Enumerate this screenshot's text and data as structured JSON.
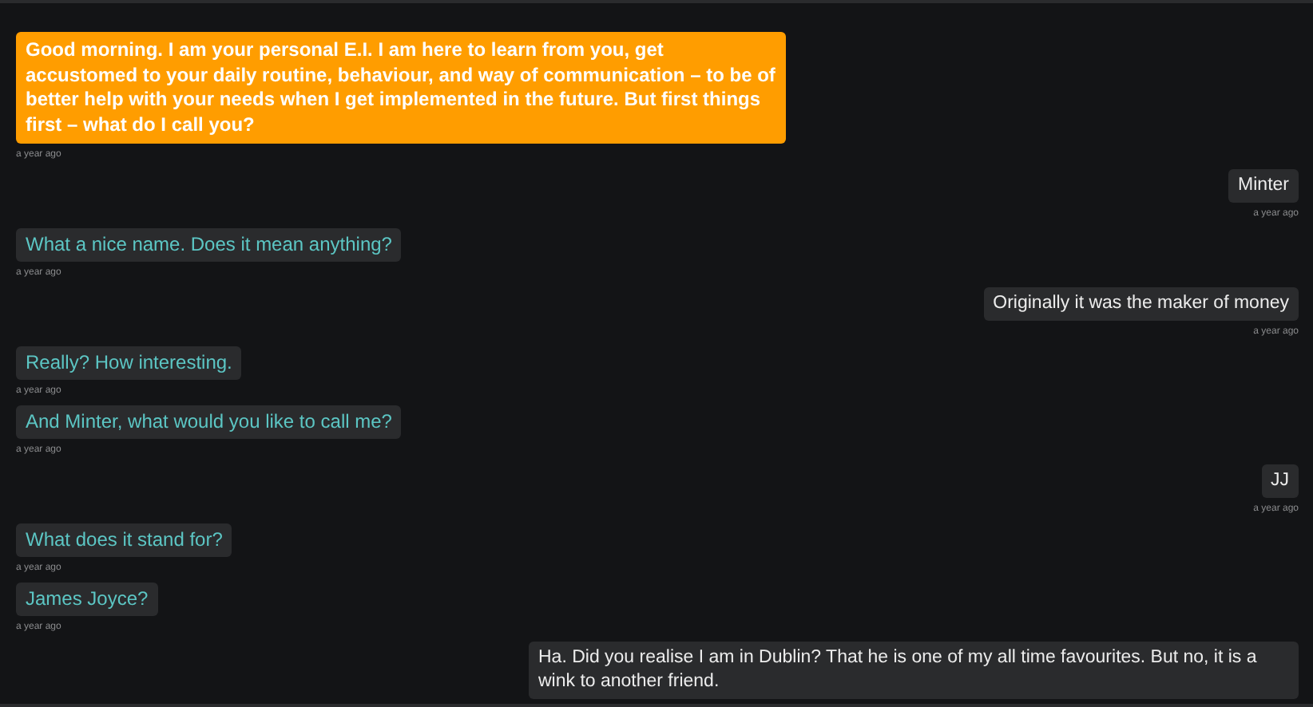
{
  "messages": [
    {
      "kind": "bot-highlight",
      "text": "Good morning. I am your personal E.I. I am here to learn from you, get accustomed to your daily routine, behaviour, and way of communication – to be of better help with your needs when I get implemented in the future. But first things first – what do I call you?",
      "time": "a year ago"
    },
    {
      "kind": "user",
      "text": "Minter",
      "time": "a year ago"
    },
    {
      "kind": "bot",
      "text": "What a nice name. Does it mean anything?",
      "time": "a year ago"
    },
    {
      "kind": "user",
      "text": "Originally it was the maker of money",
      "time": "a year ago"
    },
    {
      "kind": "bot",
      "text": "Really? How interesting.",
      "time": "a year ago"
    },
    {
      "kind": "bot",
      "text": "And Minter, what would you like to call me?",
      "time": "a year ago"
    },
    {
      "kind": "user",
      "text": "JJ",
      "time": "a year ago"
    },
    {
      "kind": "bot",
      "text": "What does it stand for?",
      "time": "a year ago"
    },
    {
      "kind": "bot",
      "text": "James Joyce?",
      "time": "a year ago"
    },
    {
      "kind": "user",
      "text": "Ha. Did you realise I am in Dublin? That he is one of my all time favourites. But no, it is a wink to another friend."
    }
  ]
}
